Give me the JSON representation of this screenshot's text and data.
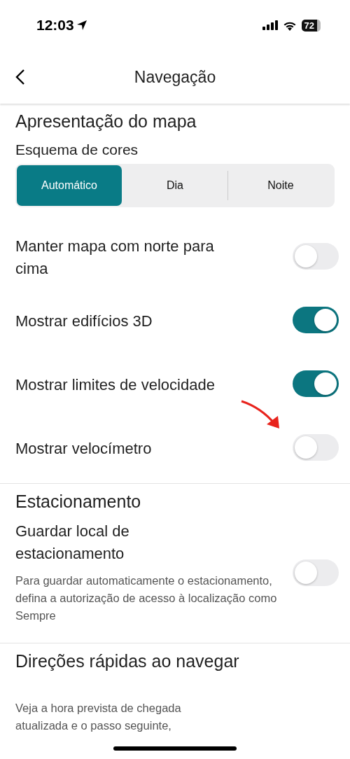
{
  "status_bar": {
    "time": "12:03",
    "battery": "72"
  },
  "header": {
    "title": "Navegação"
  },
  "sections": [
    {
      "title": "Apresentação do mapa",
      "subtitle": "Esquema de cores",
      "segments": [
        {
          "label": "Automático",
          "selected": true
        },
        {
          "label": "Dia",
          "selected": false
        },
        {
          "label": "Noite",
          "selected": false
        }
      ],
      "rows": [
        {
          "label": "Manter mapa com norte para cima",
          "on": false
        },
        {
          "label": "Mostrar edifícios 3D",
          "on": true
        },
        {
          "label": "Mostrar limites de velocidade",
          "on": true
        },
        {
          "label": "Mostrar velocímetro",
          "on": false,
          "annotated": true
        }
      ]
    },
    {
      "title": "Estacionamento",
      "rows": [
        {
          "label": "Guardar local de estacionamento",
          "description": "Para guardar automaticamente o estacionamento, defina a autorização de acesso à localização como Sempre",
          "on": false
        }
      ]
    },
    {
      "title": "Direções rápidas ao navegar",
      "description": "Veja a hora prevista de chegada atualizada e o passo seguinte,"
    }
  ]
}
